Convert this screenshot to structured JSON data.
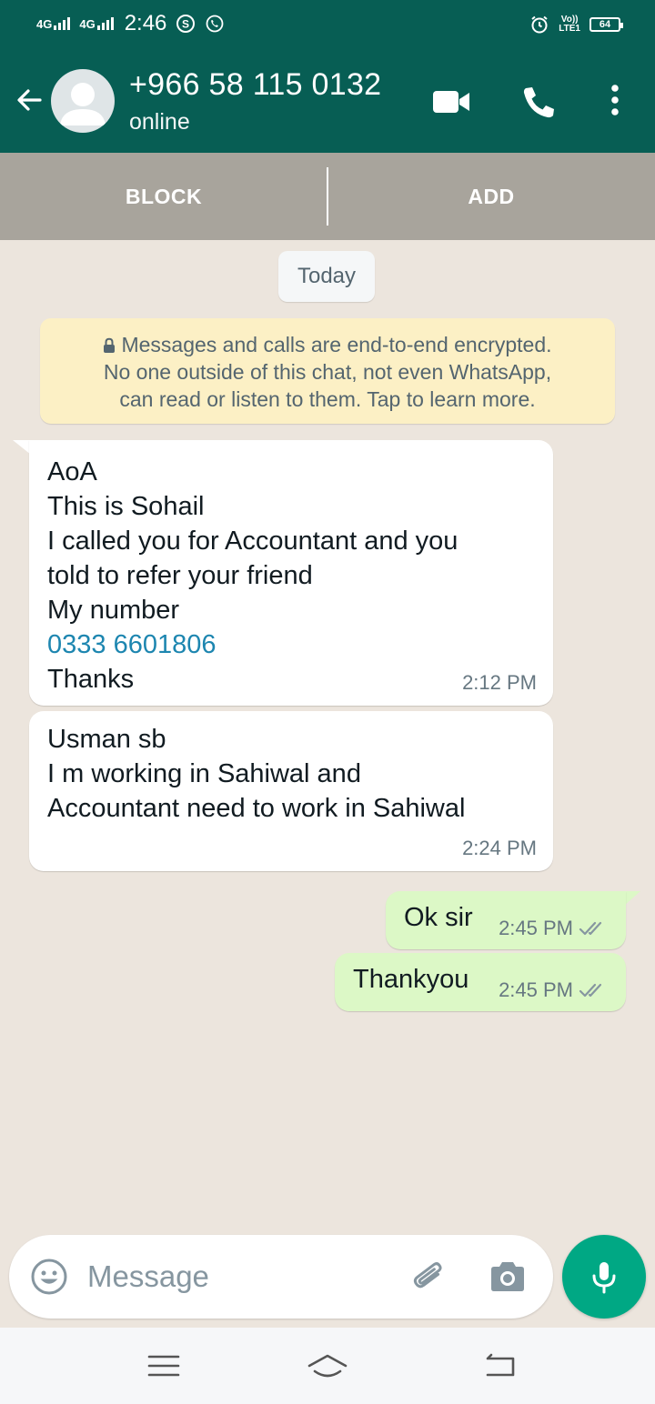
{
  "status_bar": {
    "network1": "4G",
    "network2": "4G",
    "time": "2:46",
    "volte_top": "Vo))",
    "volte_bottom": "LTE1",
    "battery": "64"
  },
  "header": {
    "contact_name": "+966 58 115 0132",
    "status": "online"
  },
  "actions": {
    "block": "BLOCK",
    "add": "ADD"
  },
  "chat": {
    "date": "Today",
    "encryption_notice": "Messages and calls are end-to-end encrypted. No one outside of this chat, not even WhatsApp, can read or listen to them. Tap to learn more.",
    "encryption_lines": [
      "Messages and calls are end-to-end encrypted.",
      "No one outside of this chat, not even WhatsApp,",
      "can read or listen to them. Tap to learn more."
    ],
    "messages": [
      {
        "direction": "incoming",
        "lines": [
          "AoA",
          "This is Sohail",
          "I called you for Accountant and you",
          "told to refer your friend",
          "My number",
          "0333 6601806",
          "Thanks"
        ],
        "time": "2:12 PM"
      },
      {
        "direction": "incoming",
        "lines": [
          "Usman sb",
          "I m working in Sahiwal and",
          "Accountant need to work in Sahiwal"
        ],
        "time": "2:24 PM"
      },
      {
        "direction": "outgoing",
        "lines": [
          "Ok sir"
        ],
        "time": "2:45 PM",
        "status": "read"
      },
      {
        "direction": "outgoing",
        "lines": [
          "Thankyou"
        ],
        "time": "2:45 PM",
        "status": "read"
      }
    ]
  },
  "composer": {
    "placeholder": "Message"
  },
  "icons": {
    "back": "arrow-left-icon",
    "video": "video-camera-icon",
    "call": "phone-icon",
    "more": "more-vertical-icon",
    "emoji": "emoji-icon",
    "attach": "paperclip-icon",
    "camera": "camera-icon",
    "mic": "microphone-icon"
  },
  "colors": {
    "header": "#075e54",
    "chat_background": "#ece5dd",
    "outgoing_bubble": "#dcf8c6",
    "incoming_bubble": "#ffffff",
    "mic_button": "#00a884",
    "link": "#1d86b0",
    "read_ticks": "#8696a0"
  }
}
